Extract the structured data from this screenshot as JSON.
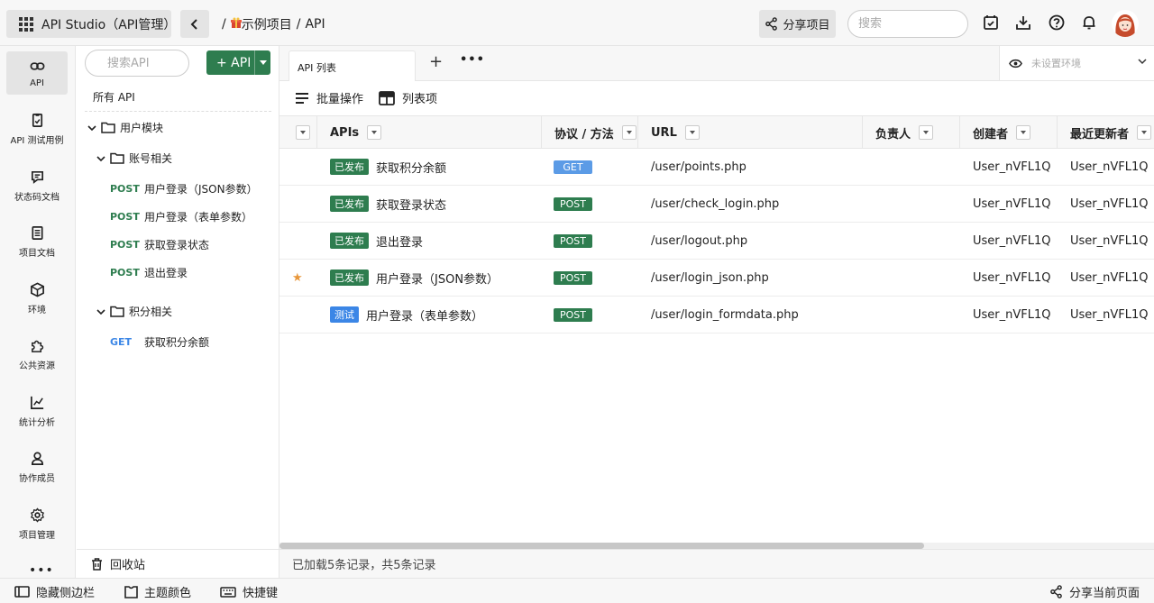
{
  "app": {
    "title": "API Studio（API管理）"
  },
  "breadcrumb": {
    "sep1": "/",
    "project": "示例项目",
    "sep2": "/",
    "page": "API"
  },
  "header": {
    "share_project": "分享项目",
    "search_placeholder": "搜索"
  },
  "leftnav": [
    {
      "label": "API",
      "icon": "link-icon"
    },
    {
      "label": "API 测试用例",
      "icon": "test-case-icon"
    },
    {
      "label": "状态码文档",
      "icon": "status-doc-icon"
    },
    {
      "label": "项目文档",
      "icon": "project-doc-icon"
    },
    {
      "label": "环境",
      "icon": "cube-icon"
    },
    {
      "label": "公共资源",
      "icon": "puzzle-icon"
    },
    {
      "label": "统计分析",
      "icon": "chart-icon"
    },
    {
      "label": "协作成员",
      "icon": "member-icon"
    },
    {
      "label": "项目管理",
      "icon": "gear-icon"
    }
  ],
  "nav_more": "•••",
  "tree": {
    "search_placeholder": "搜索API",
    "add_label": "+ API",
    "all_api": "所有 API",
    "folders": {
      "user": "用户模块",
      "account": "账号相关",
      "points": "积分相关"
    },
    "account_apis": [
      {
        "method": "POST",
        "name": "用户登录（JSON参数）"
      },
      {
        "method": "POST",
        "name": "用户登录（表单参数）"
      },
      {
        "method": "POST",
        "name": "获取登录状态"
      },
      {
        "method": "POST",
        "name": "退出登录"
      }
    ],
    "points_apis": [
      {
        "method": "GET",
        "name": "获取积分余额"
      }
    ],
    "recycle": "回收站"
  },
  "tabs": {
    "api_list": "API 列表",
    "add": "+",
    "more": "•••"
  },
  "env": {
    "placeholder": "未设置环境"
  },
  "toolbar": {
    "batch": "批量操作",
    "columns": "列表项"
  },
  "table": {
    "headers": {
      "apis": "APIs",
      "method": "协议 / 方法",
      "url": "URL",
      "owner": "负责人",
      "creator": "创建者",
      "updater": "最近更新者"
    },
    "rows": [
      {
        "star": "",
        "status": "已发布",
        "status_type": "pub",
        "name": "获取积分余额",
        "method": "GET",
        "url": "/user/points.php",
        "owner": "",
        "creator": "User_nVFL1Q",
        "updater": "User_nVFL1Q"
      },
      {
        "star": "",
        "status": "已发布",
        "status_type": "pub",
        "name": "获取登录状态",
        "method": "POST",
        "url": "/user/check_login.php",
        "owner": "",
        "creator": "User_nVFL1Q",
        "updater": "User_nVFL1Q"
      },
      {
        "star": "",
        "status": "已发布",
        "status_type": "pub",
        "name": "退出登录",
        "method": "POST",
        "url": "/user/logout.php",
        "owner": "",
        "creator": "User_nVFL1Q",
        "updater": "User_nVFL1Q"
      },
      {
        "star": "★",
        "status": "已发布",
        "status_type": "pub",
        "name": "用户登录（JSON参数）",
        "method": "POST",
        "url": "/user/login_json.php",
        "owner": "",
        "creator": "User_nVFL1Q",
        "updater": "User_nVFL1Q"
      },
      {
        "star": "",
        "status": "测试",
        "status_type": "test",
        "name": "用户登录（表单参数）",
        "method": "POST",
        "url": "/user/login_formdata.php",
        "owner": "",
        "creator": "User_nVFL1Q",
        "updater": "User_nVFL1Q"
      }
    ]
  },
  "footer": {
    "records": "已加载5条记录，共5条记录"
  },
  "bottombar": {
    "hide_sidebar": "隐藏侧边栏",
    "theme": "主题颜色",
    "shortcuts": "快捷键",
    "share_page": "分享当前页面"
  },
  "colors": {
    "accent_green": "#2e7d4f",
    "get_blue": "#5b9be6",
    "test_blue": "#3b86e6",
    "star": "#e8973b"
  }
}
